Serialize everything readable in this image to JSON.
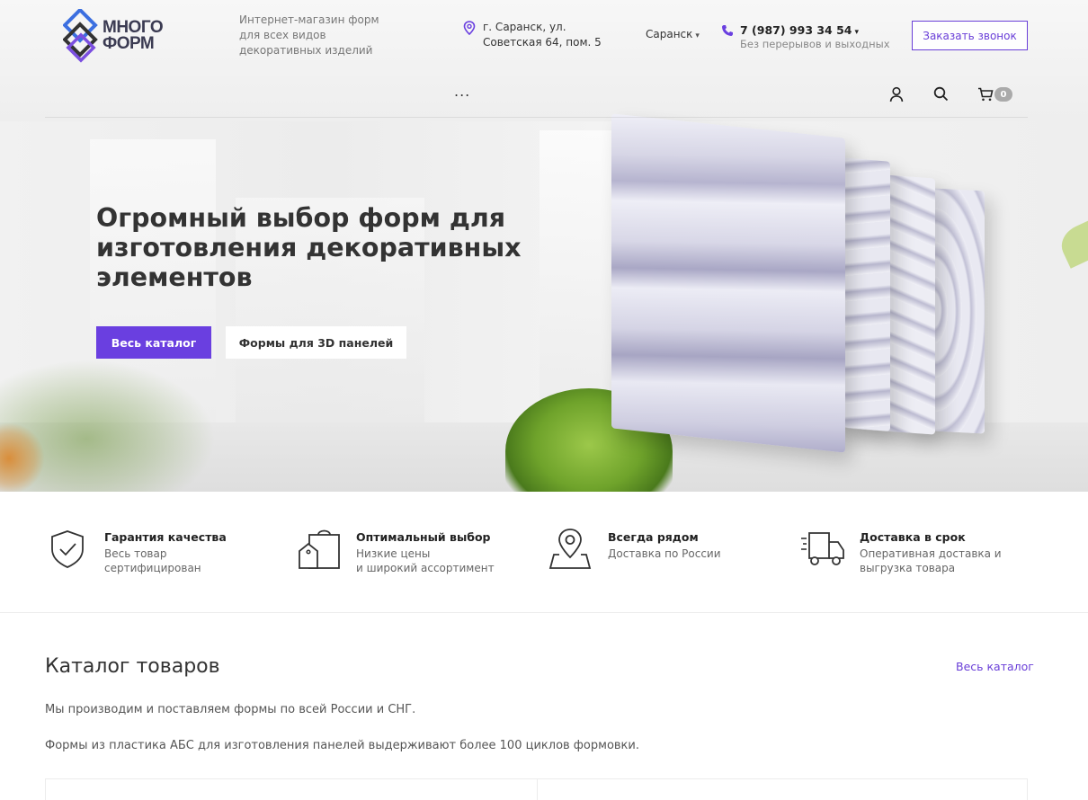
{
  "header": {
    "logo_line1": "МНОГО",
    "logo_line2": "ФОРМ",
    "tagline": "Интернет-магазин форм для всех видов декоративных изделий",
    "address_line1": "г. Саранск, ул.",
    "address_line2": "Советская 64, пом. 5",
    "city": "Саранск",
    "phone": "7 (987) 993 34 54",
    "phone_note": "Без перерывов и выходных",
    "callback_label": "Заказать звонок",
    "menu_dots": "...",
    "cart_count": "0"
  },
  "hero": {
    "title": "Огромный выбор форм для изготовления декоративных элементов",
    "primary_button": "Весь каталог",
    "secondary_button": "Формы для 3D панелей"
  },
  "features": [
    {
      "title": "Гарантия качества",
      "desc": "Весь товар сертифицирован",
      "icon": "shield-check-icon"
    },
    {
      "title": "Оптимальный выбор",
      "desc_line1": "Низкие цены",
      "desc_line2": "и широкий ассортимент",
      "icon": "shopping-bags-icon"
    },
    {
      "title": "Всегда рядом",
      "desc": "Доставка по России",
      "icon": "map-pin-icon"
    },
    {
      "title": "Доставка в срок",
      "desc_line1": "Оперативная доставка и",
      "desc_line2": "выгрузка товара",
      "icon": "delivery-truck-icon"
    }
  ],
  "catalog": {
    "title": "Каталог товаров",
    "all_link": "Весь каталог",
    "p1": "Мы производим и поставляем формы по всей России и СНГ.",
    "p2": "Формы из пластика АБС для изготовления панелей выдерживают более 100 циклов формовки."
  },
  "colors": {
    "accent": "#6a3fe0",
    "logo_blue": "#3c6fe0",
    "logo_purple": "#7b4fe0"
  }
}
